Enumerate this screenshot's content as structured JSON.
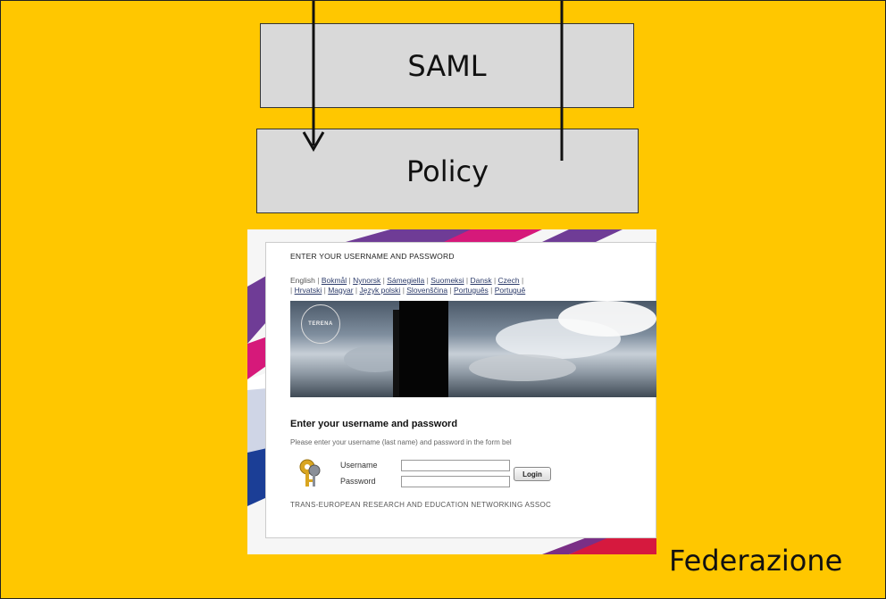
{
  "diagram": {
    "saml_label": "SAML",
    "policy_label": "Policy",
    "federation_label": "Federazione"
  },
  "login_screenshot": {
    "header": "ENTER YOUR USERNAME AND PASSWORD",
    "languages_line1": [
      {
        "text": "English",
        "link": false
      },
      {
        "text": "Bokmål",
        "link": true
      },
      {
        "text": "Nynorsk",
        "link": true
      },
      {
        "text": "Sámegiella",
        "link": true
      },
      {
        "text": "Suomeksi",
        "link": true
      },
      {
        "text": "Dansk",
        "link": true
      },
      {
        "text": "Czech",
        "link": true
      }
    ],
    "languages_line2": [
      {
        "text": "Hrvatski",
        "link": true
      },
      {
        "text": "Magyar",
        "link": true
      },
      {
        "text": "Język polski",
        "link": true
      },
      {
        "text": "Slovenščina",
        "link": true
      },
      {
        "text": "Português",
        "link": true
      },
      {
        "text": "Portuguê",
        "link": true
      }
    ],
    "logo_text": "TERENA",
    "title": "Enter your username and password",
    "help_text": "Please enter your username (last name) and password in the form bel",
    "username_label": "Username",
    "password_label": "Password",
    "login_button": "Login",
    "footer": "TRANS-EUROPEAN RESEARCH AND EDUCATION NETWORKING ASSOC"
  }
}
